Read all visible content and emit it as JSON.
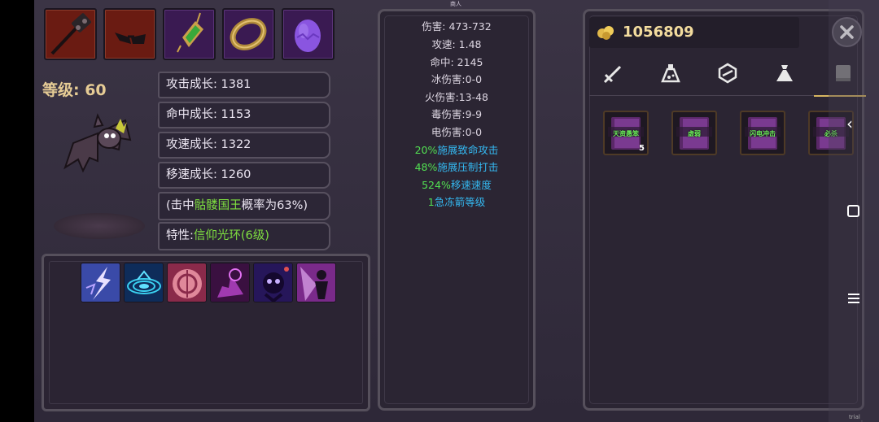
{
  "header": {
    "center_title": "商人"
  },
  "equipment": [
    {
      "name": "hammer",
      "color": "#6a1b12"
    },
    {
      "name": "goggles",
      "color": "#6a1b12"
    },
    {
      "name": "emerald-amulet",
      "color": "#3a1a52"
    },
    {
      "name": "golden-ring",
      "color": "#3a1a52"
    },
    {
      "name": "purple-egg",
      "color": "#3a1a52"
    }
  ],
  "pet": {
    "level_label": "等级: 60"
  },
  "growth_stats": {
    "attack": "攻击成长: 1381",
    "hit": "命中成长: 1153",
    "speed": "攻速成长: 1322",
    "move": "移速成长: 1260"
  },
  "hit_info": {
    "prefix": "(击中",
    "target": "骷髅国王",
    "suffix": "概率为63%)"
  },
  "trait": {
    "prefix": "特性:",
    "name": "信仰光环(6级)"
  },
  "skills": [
    "lightning-skill",
    "vortex-skill",
    "rune-skill",
    "dark-hand-skill",
    "shadow-spirit-skill",
    "holy-light-skill"
  ],
  "center_stats": {
    "damage": "伤害: 473-732",
    "attack_speed": "攻速: 1.48",
    "accuracy": "命中: 2145",
    "ice_damage": "冰伤害:0-0",
    "fire_damage": "火伤害:13-48",
    "poison_damage": "毒伤害:9-9",
    "electric_damage": "电伤害:0-0"
  },
  "bonuses": [
    {
      "value": "20%",
      "text": "施展致命攻击"
    },
    {
      "value": "48%",
      "text": "施展压制打击"
    },
    {
      "value": "524%",
      "text": "移速速度"
    },
    {
      "value": "1",
      "text": "急冻箭等级"
    }
  ],
  "inventory": {
    "gold": "1056809",
    "tabs": [
      "sword-tab",
      "potion-tab",
      "gem-tab",
      "bag-tab",
      "book-tab"
    ],
    "items": [
      {
        "name": "天资愚笨",
        "count": "5"
      },
      {
        "name": "虚弱",
        "count": ""
      },
      {
        "name": "闪电冲击",
        "count": ""
      },
      {
        "name": "必杀",
        "count": ""
      }
    ]
  },
  "footer": {
    "trial": "trial version"
  }
}
